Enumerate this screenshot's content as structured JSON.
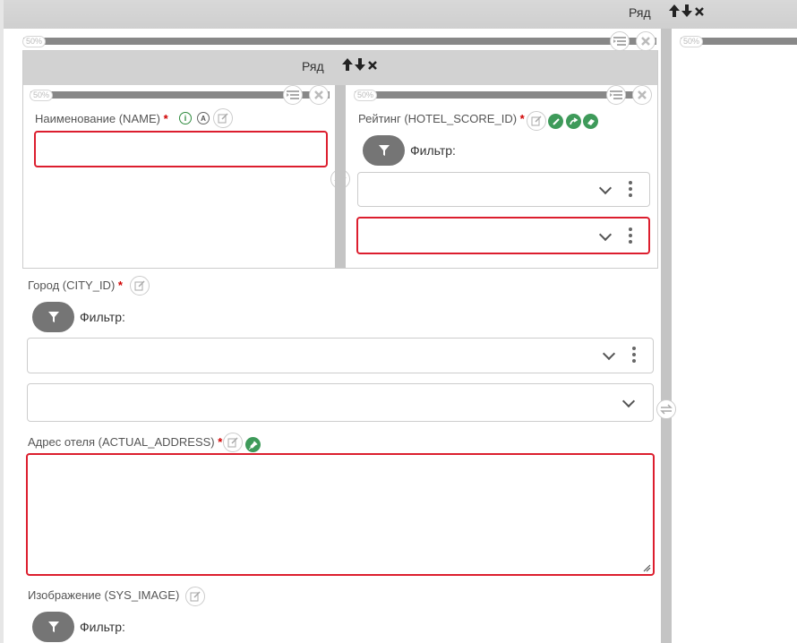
{
  "outer_row": {
    "label": "Ряд",
    "arrows": "🡅🡇×"
  },
  "outer_col_left": {
    "percent": "50%"
  },
  "outer_col_right": {
    "percent": "50%"
  },
  "inner_row": {
    "label": "Ряд",
    "arrows": "🡅🡇×"
  },
  "inner_col_left": {
    "percent": "50%"
  },
  "inner_col_right": {
    "percent": "50%"
  },
  "fields": {
    "name": {
      "label": "Наименование (NAME)",
      "required": "*",
      "info": "i",
      "auto": "A",
      "value": ""
    },
    "hotel_score": {
      "label": "Рейтинг (HOTEL_SCORE_ID)",
      "required": "*",
      "filter_label": "Фильтр:",
      "select1": "",
      "select2": ""
    },
    "city": {
      "label": "Город (CITY_ID)",
      "required": "*",
      "filter_label": "Фильтр:",
      "select1": "",
      "select2": ""
    },
    "address": {
      "label": "Адрес отеля (ACTUAL_ADDRESS)",
      "required": "*",
      "value": ""
    },
    "image": {
      "label": "Изображение (SYS_IMAGE)",
      "filter_label": "Фильтр:"
    }
  },
  "colors": {
    "error": "#dc1e2e",
    "accent_green": "#3e9a5a",
    "bar": "#888888",
    "header": "#d2d2d2"
  }
}
